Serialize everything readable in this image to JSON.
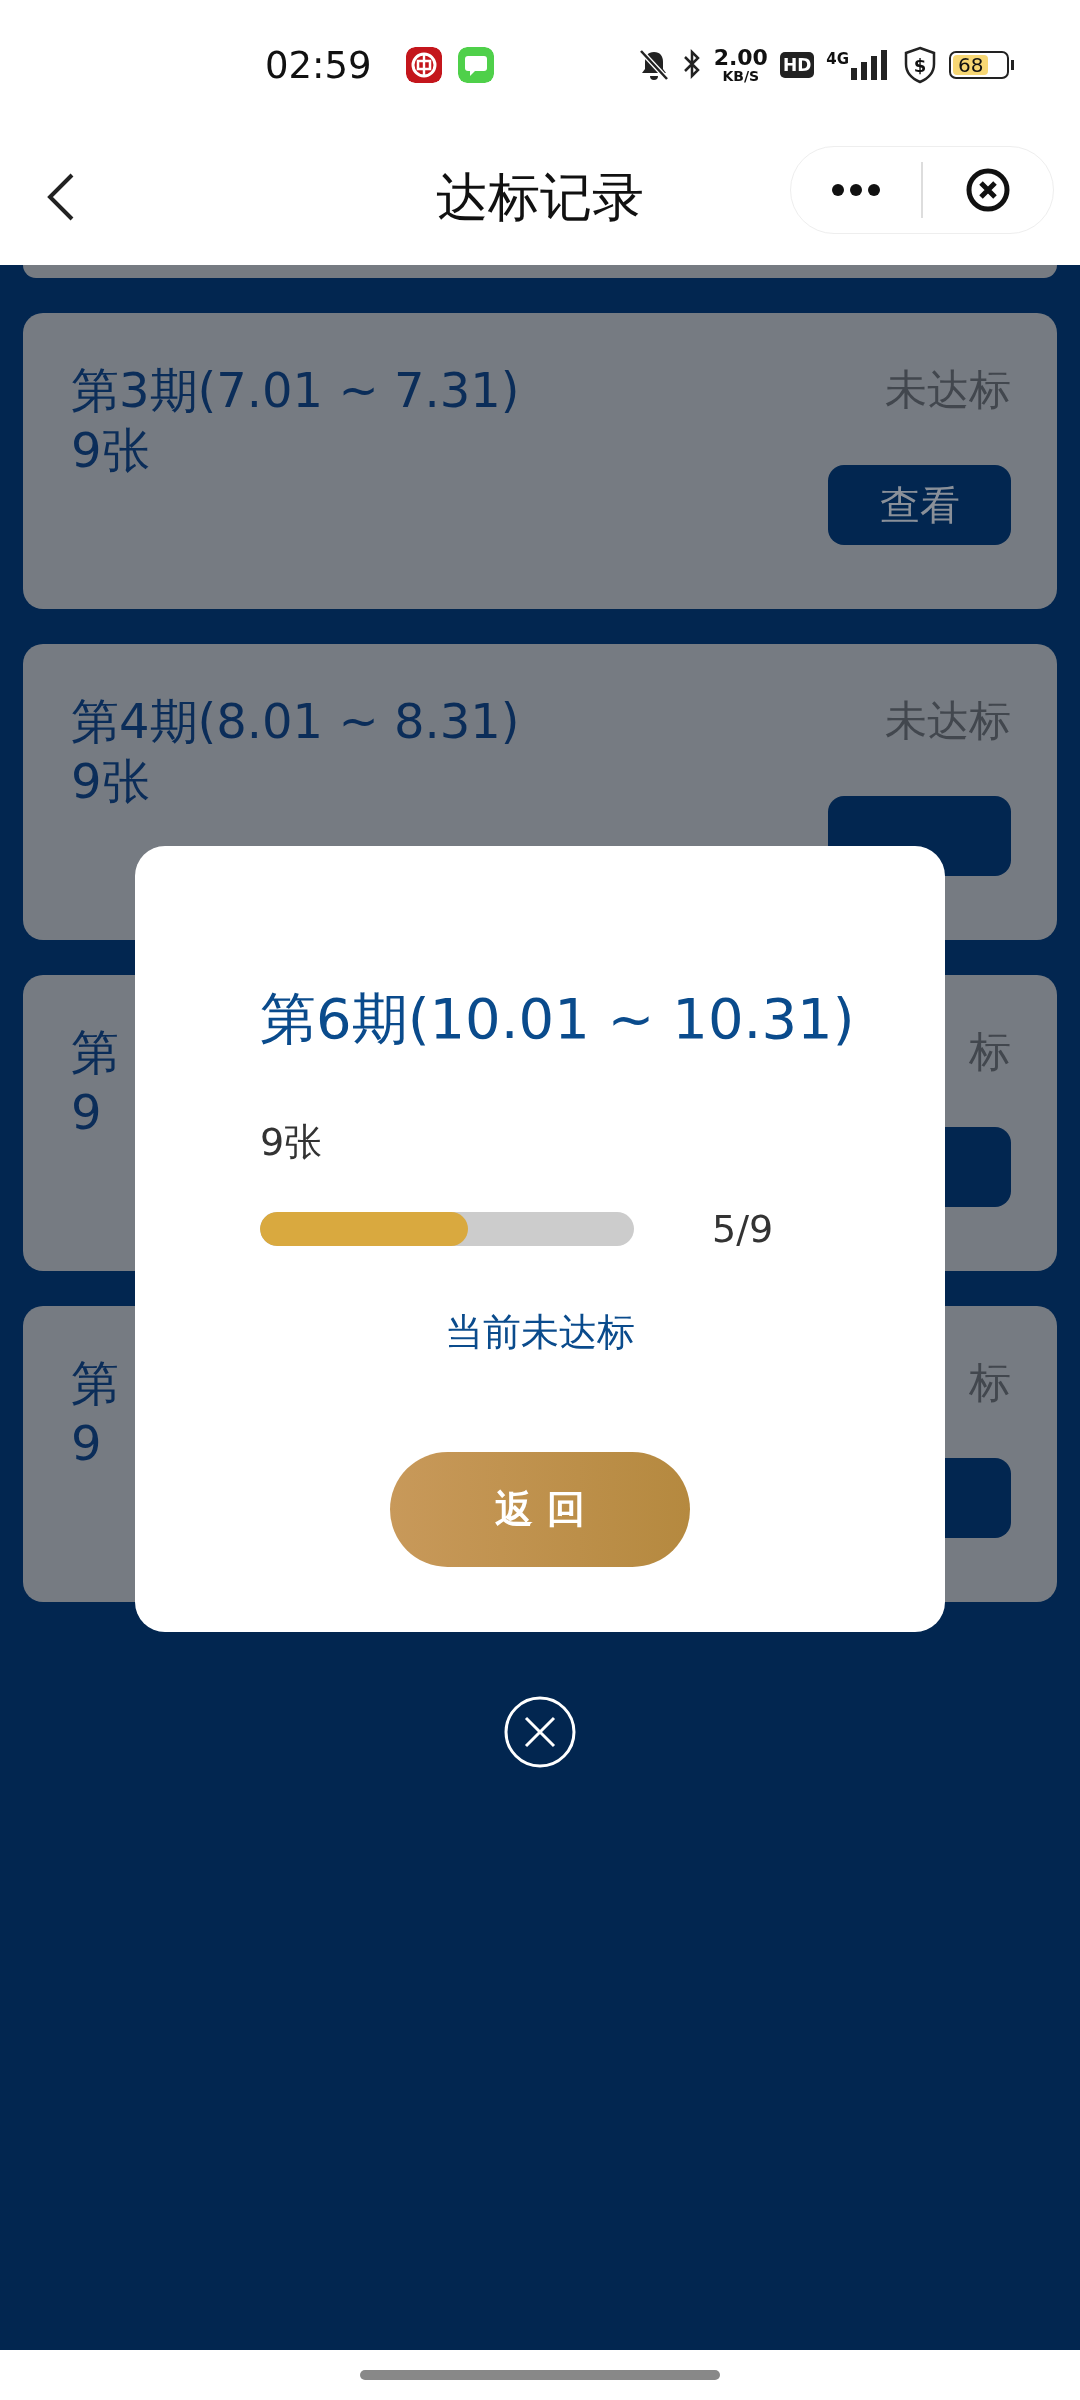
{
  "status_bar": {
    "time": "02:59",
    "network_speed": "2.00",
    "speed_unit": "KB/S",
    "hd_badge": "HD",
    "network_type": "4G",
    "shield_symbol": "$",
    "battery": "68"
  },
  "nav": {
    "title": "达标记录"
  },
  "records": [
    {
      "kind": "partial"
    },
    {
      "kind": "full",
      "title": "第3期(7.01 ~ 7.31)",
      "count": "9张",
      "status": "未达标",
      "button": "查看"
    },
    {
      "kind": "full",
      "title": "第4期(8.01 ~ 8.31)",
      "count": "9张",
      "status": "未达标"
    },
    {
      "kind": "covered",
      "title": "第",
      "count": "9",
      "status": "标"
    },
    {
      "kind": "covered",
      "title": "第",
      "count": "9",
      "status": "标"
    }
  ],
  "dialog": {
    "title": "第6期(10.01 ~ 10.31)",
    "count": "9张",
    "level": 0.555,
    "reading": "5/9",
    "status": "当前未达标",
    "button": "返 回"
  }
}
